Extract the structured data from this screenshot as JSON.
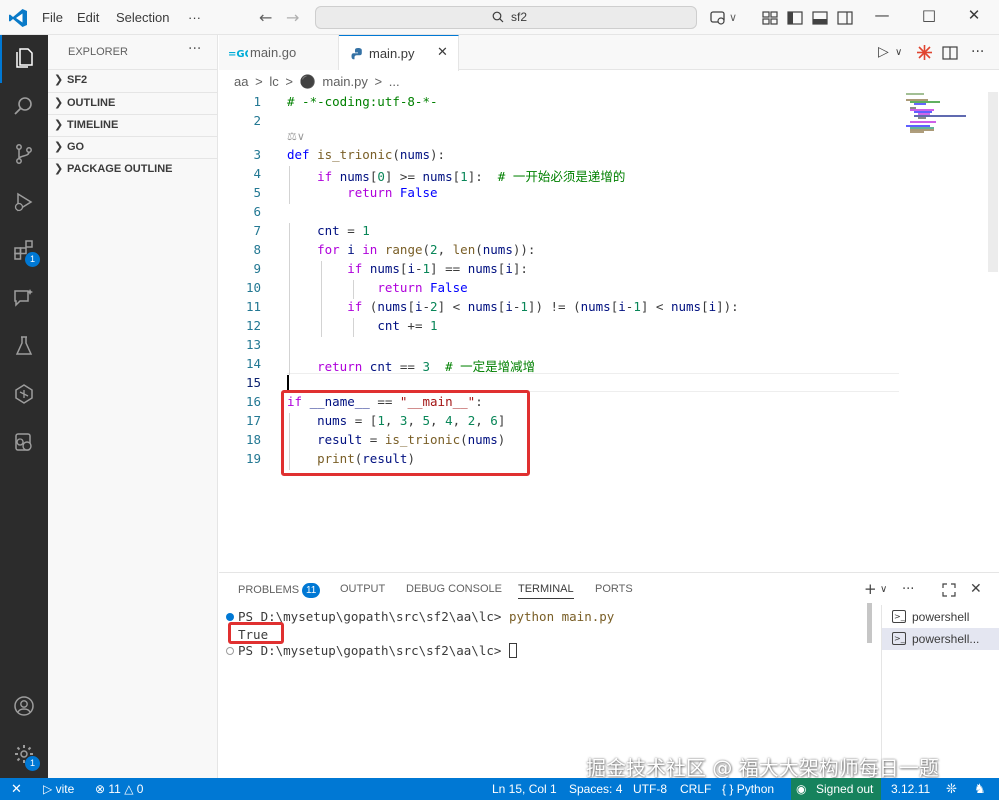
{
  "titlebar": {
    "menu": [
      "File",
      "Edit",
      "Selection",
      "···"
    ],
    "search_text": "sf2"
  },
  "activitybar": {
    "extensions_badge": "1",
    "accounts_badge": "1"
  },
  "sidebar": {
    "title": "EXPLORER",
    "sections": [
      "SF2",
      "OUTLINE",
      "TIMELINE",
      "GO",
      "PACKAGE OUTLINE"
    ]
  },
  "tabs": [
    {
      "label": "main.go",
      "active": false
    },
    {
      "label": "main.py",
      "active": true
    }
  ],
  "breadcrumb": [
    "aa",
    ">",
    "lc",
    ">",
    "main.py",
    ">",
    "..."
  ],
  "editor": {
    "line_numbers": [
      "1",
      "2",
      "3",
      "4",
      "5",
      "6",
      "7",
      "8",
      "9",
      "10",
      "11",
      "12",
      "13",
      "14",
      "15",
      "16",
      "17",
      "18",
      "19"
    ],
    "lines": [
      "# -*-coding:utf-8-*-",
      "",
      "def is_trionic(nums):",
      "    if nums[0] >= nums[1]:  # 一开始必须是递增的",
      "        return False",
      "",
      "    cnt = 1",
      "    for i in range(2, len(nums)):",
      "        if nums[i-1] == nums[i]:",
      "            return False",
      "        if (nums[i-2] < nums[i-1]) != (nums[i-1] < nums[i]):",
      "            cnt += 1",
      "",
      "    return cnt == 3  # 一定是增减增",
      "",
      "if __name__ == \"__main__\":",
      "    nums = [1, 3, 5, 4, 2, 6]",
      "    result = is_trionic(nums)",
      "    print(result)"
    ],
    "copilot_hint": "⚖∨"
  },
  "panel": {
    "tabs": [
      "PROBLEMS",
      "OUTPUT",
      "DEBUG CONSOLE",
      "TERMINAL",
      "PORTS"
    ],
    "problems_badge": "11",
    "active_tab": "TERMINAL",
    "terminal_lines": [
      "PS D:\\mysetup\\gopath\\src\\sf2\\aa\\lc> ",
      "True",
      "PS D:\\mysetup\\gopath\\src\\sf2\\aa\\lc> "
    ],
    "command": "python main.py",
    "terminals": [
      "powershell",
      "powershell..."
    ]
  },
  "statusbar": {
    "remote": "✕",
    "vite": "vite",
    "errors": "11",
    "warnings": "0",
    "position": "Ln 15, Col 1",
    "spaces": "Spaces: 4",
    "encoding": "UTF-8",
    "eol": "CRLF",
    "language": "Python",
    "signed": "Signed out",
    "version": "3.12.11"
  },
  "watermark": "掘金技术社区 @ 福大大架构师每日一题",
  "colors": {
    "accent": "#0078d4",
    "highlight_box": "#e03030",
    "status_signed": "#16825d"
  }
}
